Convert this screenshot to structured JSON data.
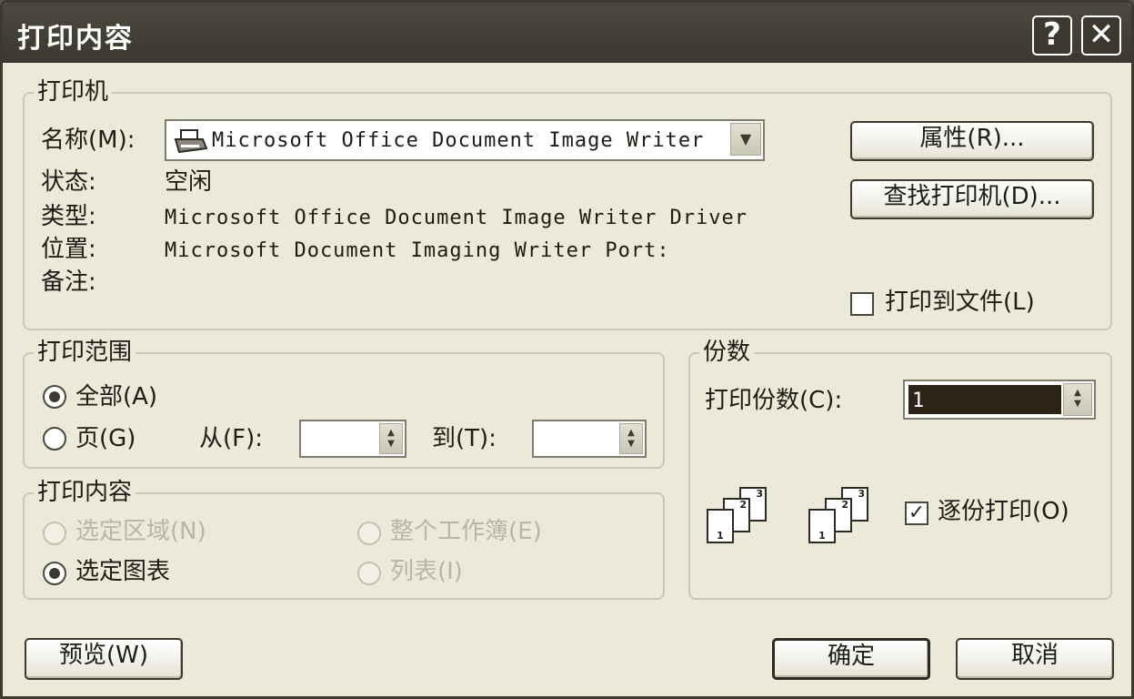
{
  "dialog": {
    "title": "打印内容",
    "help_glyph": "?",
    "close_glyph": "✕"
  },
  "printer": {
    "group_label": "打印机",
    "name_label": "名称(M):",
    "name_value": "Microsoft Office Document Image Writer",
    "status_label": "状态:",
    "status_value": "空闲",
    "type_label": "类型:",
    "type_value": "Microsoft Office Document Image Writer Driver",
    "location_label": "位置:",
    "location_value": "Microsoft Document Imaging Writer Port:",
    "comment_label": "备注:",
    "properties_button": "属性(R)...",
    "find_printer_button": "查找打印机(D)...",
    "print_to_file_label": "打印到文件(L)",
    "print_to_file_checked": false
  },
  "range": {
    "group_label": "打印范围",
    "all_label": "全部(A)",
    "pages_label": "页(G)",
    "from_label": "从(F):",
    "to_label": "到(T):",
    "from_value": "",
    "to_value": "",
    "selected": "all"
  },
  "copies": {
    "group_label": "份数",
    "count_label": "打印份数(C):",
    "count_value": "1",
    "collate_label": "逐份打印(O)",
    "collate_checked": true,
    "check_glyph": "✓",
    "page_numbers": [
      "1",
      "2",
      "3"
    ]
  },
  "content": {
    "group_label": "打印内容",
    "selection_label": "选定区域(N)",
    "workbook_label": "整个工作簿(E)",
    "chart_label": "选定图表",
    "list_label": "列表(I)",
    "selected": "chart"
  },
  "footer": {
    "preview_button": "预览(W)",
    "ok_button": "确定",
    "cancel_button": "取消"
  },
  "icons": {
    "printer": "printer-icon",
    "dropdown": "chevron-down-icon",
    "spin": "spin-updown-icon"
  }
}
